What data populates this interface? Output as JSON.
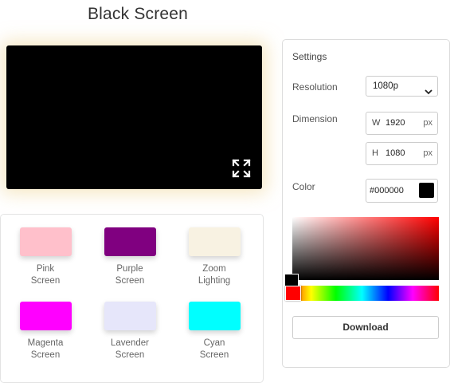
{
  "page": {
    "title": "Black Screen"
  },
  "preview": {
    "background": "#000000",
    "fullscreen_icon": "expand-arrows-icon"
  },
  "swatches": [
    {
      "label": "Pink\nScreen",
      "color": "#ffc0cb"
    },
    {
      "label": "Purple\nScreen",
      "color": "#800080"
    },
    {
      "label": "Zoom\nLighting",
      "color": "#f8f2e2"
    },
    {
      "label": "Magenta\nScreen",
      "color": "#ff00ff"
    },
    {
      "label": "Lavender\nScreen",
      "color": "#e6e6fa"
    },
    {
      "label": "Cyan\nScreen",
      "color": "#00ffff"
    }
  ],
  "settings": {
    "title": "Settings",
    "resolution_label": "Resolution",
    "resolution_value": "1080p",
    "dimension_label": "Dimension",
    "width_prefix": "W",
    "width_value": "1920",
    "height_prefix": "H",
    "height_value": "1080",
    "unit": "px",
    "color_label": "Color",
    "color_value": "#000000",
    "download_label": "Download"
  }
}
